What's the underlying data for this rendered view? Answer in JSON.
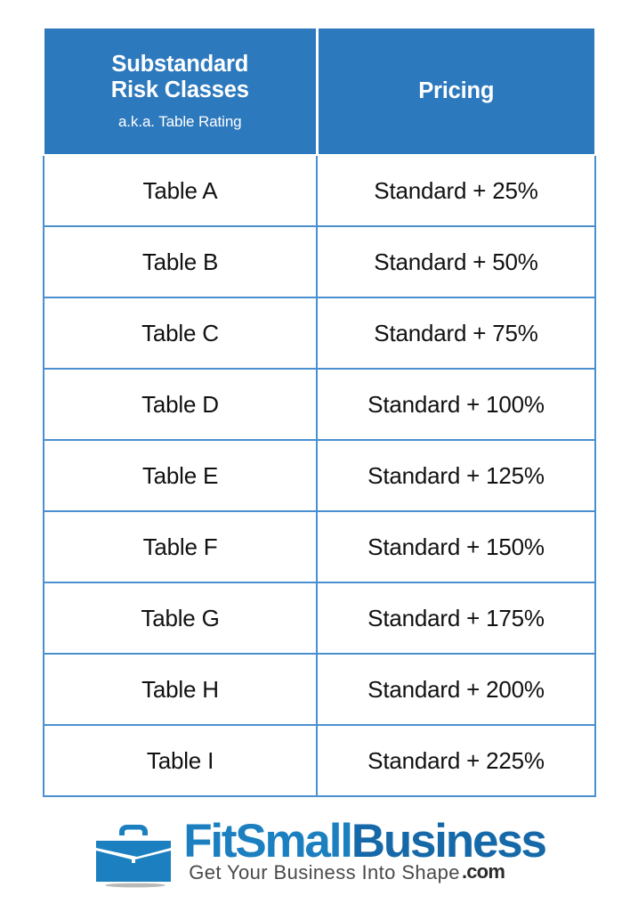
{
  "colors": {
    "header_blue": "#2d79bd",
    "border_blue": "#4a90d0",
    "logo_blue": "#1b7fc0",
    "logo_blue_dark": "#1669a8",
    "text_dark": "#111111",
    "background": "#ffffff"
  },
  "table": {
    "headers": {
      "class_title_line1": "Substandard",
      "class_title_line2": "Risk Classes",
      "class_subtitle": "a.k.a. Table Rating",
      "pricing": "Pricing"
    },
    "rows": [
      {
        "risk_class": "Table A",
        "pricing": "Standard + 25%"
      },
      {
        "risk_class": "Table B",
        "pricing": "Standard + 50%"
      },
      {
        "risk_class": "Table C",
        "pricing": "Standard + 75%"
      },
      {
        "risk_class": "Table D",
        "pricing": "Standard + 100%"
      },
      {
        "risk_class": "Table E",
        "pricing": "Standard + 125%"
      },
      {
        "risk_class": "Table F",
        "pricing": "Standard + 150%"
      },
      {
        "risk_class": "Table G",
        "pricing": "Standard + 175%"
      },
      {
        "risk_class": "Table H",
        "pricing": "Standard + 200%"
      },
      {
        "risk_class": "Table I",
        "pricing": "Standard + 225%"
      }
    ]
  },
  "logo": {
    "icon": "briefcase-icon",
    "brand_part1": "FitSmall",
    "brand_part2": "Business",
    "tld": ".com",
    "tagline": "Get Your Business Into Shape"
  }
}
